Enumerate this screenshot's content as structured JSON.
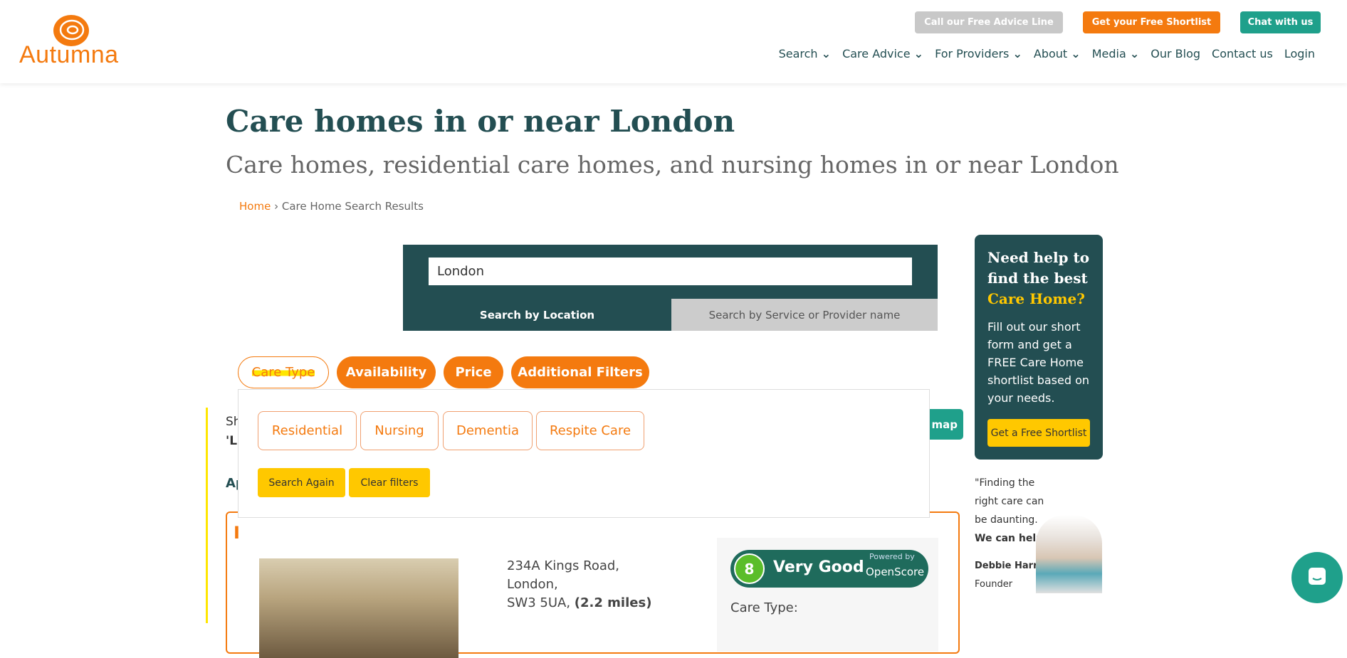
{
  "header": {
    "logo_text": "Autumna",
    "top_buttons": [
      {
        "label": "Call our Free Advice Line",
        "color": "#c8c8c8"
      },
      {
        "label": "Get your Free Shortlist",
        "color": "#f47a0f"
      },
      {
        "label": "Chat with us",
        "color": "#1fa08b"
      }
    ],
    "nav": [
      {
        "label": "Search",
        "dropdown": true
      },
      {
        "label": "Care Advice",
        "dropdown": true
      },
      {
        "label": "For Providers",
        "dropdown": true
      },
      {
        "label": "About",
        "dropdown": true
      },
      {
        "label": "Media",
        "dropdown": true
      },
      {
        "label": "Our Blog"
      },
      {
        "label": "Contact us"
      },
      {
        "label": "Login"
      }
    ]
  },
  "page": {
    "title": "Care homes in or near London",
    "subtitle": "Care homes, residential care homes, and nursing homes in or near London"
  },
  "breadcrumb": {
    "home": "Home",
    "separator": "›",
    "current": "Care Home Search Results"
  },
  "search": {
    "value": "London",
    "tabs": [
      "Search by Location",
      "Search by Service or Provider name"
    ],
    "active_tab": 0
  },
  "filters": {
    "pills": [
      "Care Type",
      "Availability",
      "Price",
      "Additional Filters"
    ],
    "open": "Care Type",
    "care_type_options": [
      "Residential",
      "Nursing",
      "Dementia",
      "Respite Care"
    ],
    "search_again": "Search Again",
    "clear": "Clear filters"
  },
  "behind": {
    "line1": "Sh",
    "line2": "'L",
    "line3": "Ap",
    "map_btn": "map",
    "card_initial": "I"
  },
  "result": {
    "address": [
      "234A Kings Road,",
      "London,",
      "SW3 5UA,"
    ],
    "distance": "(2.2 miles)",
    "score": "8",
    "rating": "Very Good",
    "powered": "Powered by",
    "brand": "OpenScore",
    "care_type_label": "Care Type:"
  },
  "sidebar": {
    "title1": "Need help to find the best",
    "title2": "Care Home?",
    "desc": "Fill out our short form and get a FREE Care Home shortlist based on your needs.",
    "button": "Get a Free Shortlist",
    "quote": "\"Finding the right care can be daunting.",
    "quote_bold": "We can help.\"",
    "name": "Debbie Harris",
    "role": "Founder"
  },
  "colors": {
    "teal": "#234e52",
    "orange": "#f47a0f",
    "yellow": "#ffc800",
    "green": "#1fa08b"
  }
}
